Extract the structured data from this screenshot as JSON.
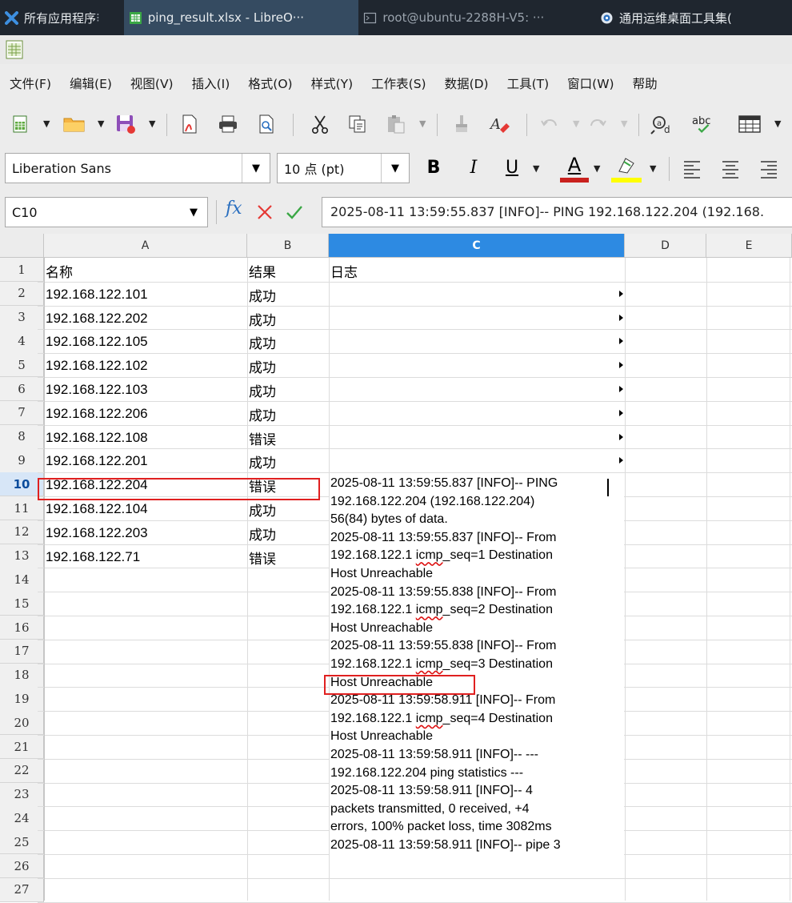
{
  "taskbar": {
    "items": [
      {
        "label": "所有应用程序",
        "icon": "xfce-icon"
      },
      {
        "label": "ping_result.xlsx - LibreO···",
        "icon": "calc-icon",
        "active": true
      },
      {
        "label": "root@ubuntu-2288H-V5: ···",
        "icon": "terminal-icon"
      },
      {
        "label": "通用运维桌面工具集(",
        "icon": "globe-icon"
      }
    ]
  },
  "menu": [
    "文件(F)",
    "编辑(E)",
    "视图(V)",
    "插入(I)",
    "格式(O)",
    "样式(Y)",
    "工作表(S)",
    "数据(D)",
    "工具(T)",
    "窗口(W)",
    "帮助"
  ],
  "format": {
    "font_name": "Liberation Sans",
    "font_size": "10 点 (pt)",
    "bold": "B",
    "italic": "I",
    "underline": "U",
    "font_color_letter": "A",
    "font_color": "#c9211e",
    "highlight_color": "#ffff00"
  },
  "formula": {
    "cell_ref": "C10",
    "fx": "fx",
    "content": "2025-08-11 13:59:55.837 [INFO]-- PING 192.168.122.204 (192.168."
  },
  "columns": [
    "A",
    "B",
    "C",
    "D",
    "E"
  ],
  "selected_column": "C",
  "rows": [
    "1",
    "2",
    "3",
    "4",
    "5",
    "6",
    "7",
    "8",
    "9",
    "10",
    "11",
    "12",
    "13",
    "14",
    "15",
    "16",
    "17",
    "18",
    "19",
    "20",
    "21",
    "22",
    "23",
    "24",
    "25",
    "26",
    "27"
  ],
  "selected_row": "10",
  "data": [
    {
      "name": "名称",
      "result": "结果",
      "log": "日志"
    },
    {
      "name": "192.168.122.101",
      "result": "成功"
    },
    {
      "name": "192.168.122.202",
      "result": "成功"
    },
    {
      "name": "192.168.122.105",
      "result": "成功"
    },
    {
      "name": "192.168.122.102",
      "result": "成功"
    },
    {
      "name": "192.168.122.103",
      "result": "成功"
    },
    {
      "name": "192.168.122.206",
      "result": "成功"
    },
    {
      "name": "192.168.122.108",
      "result": "错误"
    },
    {
      "name": "192.168.122.201",
      "result": "成功"
    },
    {
      "name": "192.168.122.204",
      "result": "错误"
    },
    {
      "name": "192.168.122.104",
      "result": "成功"
    },
    {
      "name": "192.168.122.203",
      "result": "成功"
    },
    {
      "name": "192.168.122.71",
      "result": "错误"
    }
  ],
  "c10_log_lines": [
    "2025-08-11 13:59:55.837 [INFO]-- PING",
    "192.168.122.204 (192.168.122.204)",
    "56(84) bytes of data.",
    "2025-08-11 13:59:55.837 [INFO]-- From",
    "192.168.122.1 icmp_seq=1 Destination",
    "Host Unreachable",
    "2025-08-11 13:59:55.838 [INFO]-- From",
    "192.168.122.1 icmp_seq=2 Destination",
    "Host Unreachable",
    "2025-08-11 13:59:55.838 [INFO]-- From",
    "192.168.122.1 icmp_seq=3 Destination",
    "Host Unreachable",
    "2025-08-11 13:59:58.911 [INFO]-- From",
    "192.168.122.1 icmp_seq=4 Destination",
    "Host Unreachable",
    "2025-08-11 13:59:58.911 [INFO]-- ---",
    "192.168.122.204 ping statistics ---",
    "2025-08-11 13:59:58.911 [INFO]-- 4",
    "packets transmitted, 0 received, +4",
    "errors, 100% packet loss, time 3082ms",
    "2025-08-11 13:59:58.911 [INFO]-- pipe 3"
  ],
  "colors": {
    "selection_blue": "#2d8ae2",
    "highlight_red": "#e02020",
    "taskbar": "#1f262f"
  }
}
